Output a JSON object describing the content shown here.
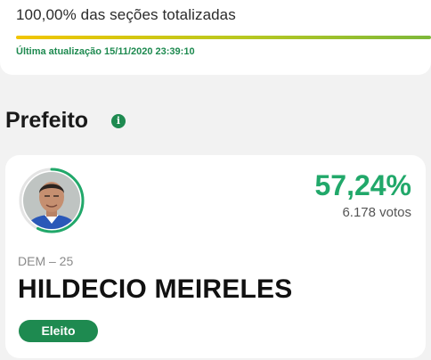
{
  "header": {
    "sections_text": "100,00% das seções totalizadas",
    "sections_progress_percent": 100,
    "last_update": "Última atualização 15/11/2020 23:39:10"
  },
  "office": {
    "title": "Prefeito",
    "info_icon": "info-icon",
    "info_glyph": "i"
  },
  "candidate": {
    "percent": "57,24%",
    "vote_share": 57.24,
    "votes": "6.178 votos",
    "party": "DEM – 25",
    "name": "HILDECIO MEIRELES",
    "status": "Eleito",
    "avatar": "candidate-photo"
  },
  "colors": {
    "accent_green": "#21a86a",
    "badge_green": "#1e8a50",
    "progress_start": "#f2c500",
    "progress_end": "#7db83a"
  }
}
